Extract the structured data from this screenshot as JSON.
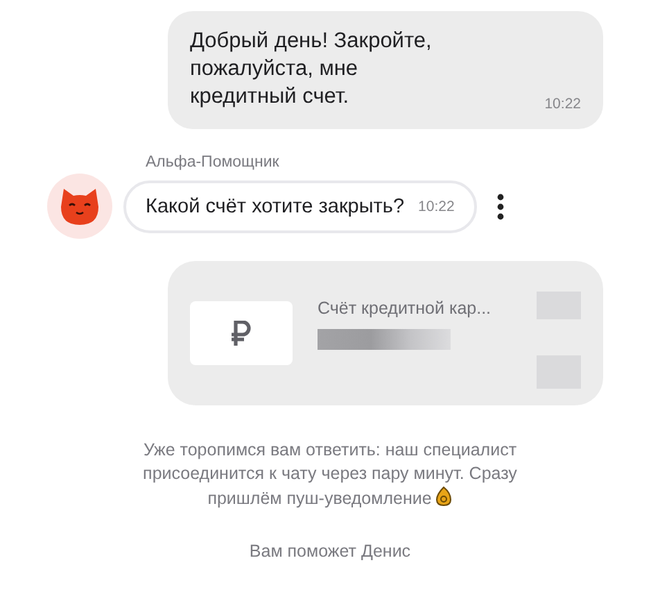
{
  "messages": [
    {
      "kind": "user",
      "text": "Добрый день! Закройте, пожалуйста, мне кредитный счет.",
      "time": "10:22"
    },
    {
      "kind": "bot",
      "sender": "Альфа-Помощник",
      "text": "Какой счёт хотите закрыть?",
      "time": "10:22"
    }
  ],
  "account_card": {
    "title": "Счёт кредитной кар..."
  },
  "notice": "Уже торопимся вам ответить: наш специалист присоединится к чату через пару минут. Сразу пришлём пуш-уведомление",
  "agent": "Вам поможет Денис"
}
